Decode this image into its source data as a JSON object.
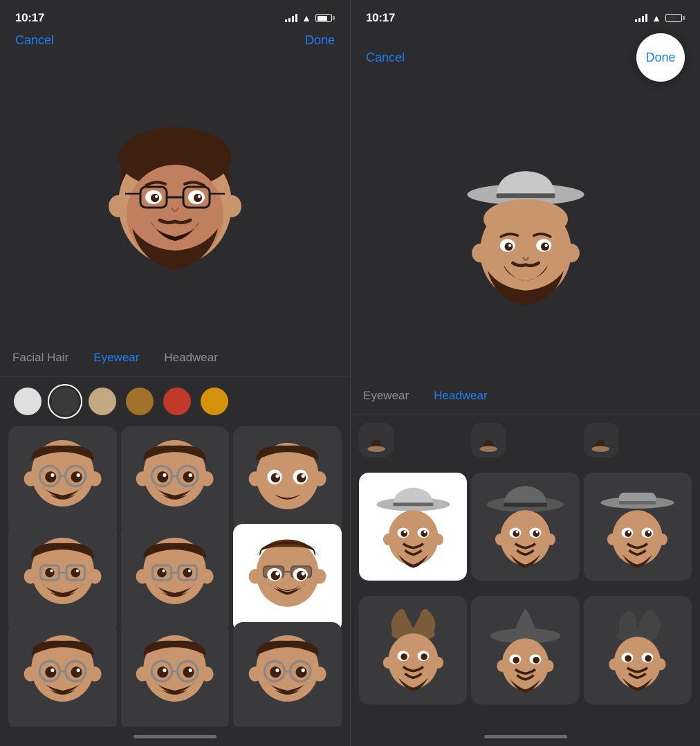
{
  "left_panel": {
    "status": {
      "time": "10:17"
    },
    "nav": {
      "cancel": "Cancel",
      "done": "Done"
    },
    "categories": [
      {
        "label": "Facial Hair",
        "active": false
      },
      {
        "label": "Eyewear",
        "active": true
      },
      {
        "label": "Headwear",
        "active": false
      }
    ],
    "colors": [
      {
        "hex": "#e0e0e0",
        "selected": false
      },
      {
        "hex": "#3a3a3a",
        "selected": true
      },
      {
        "hex": "#c4a882",
        "selected": false
      },
      {
        "hex": "#a0722a",
        "selected": false
      },
      {
        "hex": "#c0392b",
        "selected": false
      },
      {
        "hex": "#d4920a",
        "selected": false
      }
    ],
    "grid_items": [
      {
        "type": "glasses-round",
        "selected": false,
        "row": 0,
        "col": 0
      },
      {
        "type": "glasses-round-2",
        "selected": false,
        "row": 0,
        "col": 1
      },
      {
        "type": "no-glasses",
        "selected": false,
        "row": 0,
        "col": 2
      },
      {
        "type": "glasses-small",
        "selected": false,
        "row": 1,
        "col": 0
      },
      {
        "type": "glasses-small-2",
        "selected": false,
        "row": 1,
        "col": 1
      },
      {
        "type": "current-selected",
        "selected": true,
        "row": 1,
        "col": 2
      },
      {
        "type": "glasses-large",
        "selected": false,
        "row": 2,
        "col": 0
      },
      {
        "type": "glasses-large-2",
        "selected": false,
        "row": 2,
        "col": 1
      },
      {
        "type": "glasses-large-3",
        "selected": false,
        "row": 2,
        "col": 2
      }
    ]
  },
  "right_panel": {
    "status": {
      "time": "10:17"
    },
    "nav": {
      "cancel": "Cancel",
      "done": "Done"
    },
    "categories": [
      {
        "label": "Eyewear",
        "active": false
      },
      {
        "label": "Headwear",
        "active": true
      }
    ],
    "grid_items": [
      {
        "type": "cowboy-selected",
        "selected": true,
        "row": 0,
        "col": 0
      },
      {
        "type": "wide-hat",
        "selected": false,
        "row": 0,
        "col": 1
      },
      {
        "type": "flat-hat",
        "selected": false,
        "row": 0,
        "col": 2
      },
      {
        "type": "jester",
        "selected": false,
        "row": 1,
        "col": 0
      },
      {
        "type": "witch",
        "selected": false,
        "row": 1,
        "col": 1
      },
      {
        "type": "dark-hat",
        "selected": false,
        "row": 1,
        "col": 2
      }
    ]
  },
  "icons": {
    "signal": "signal-icon",
    "wifi": "wifi-icon",
    "battery": "battery-icon"
  }
}
